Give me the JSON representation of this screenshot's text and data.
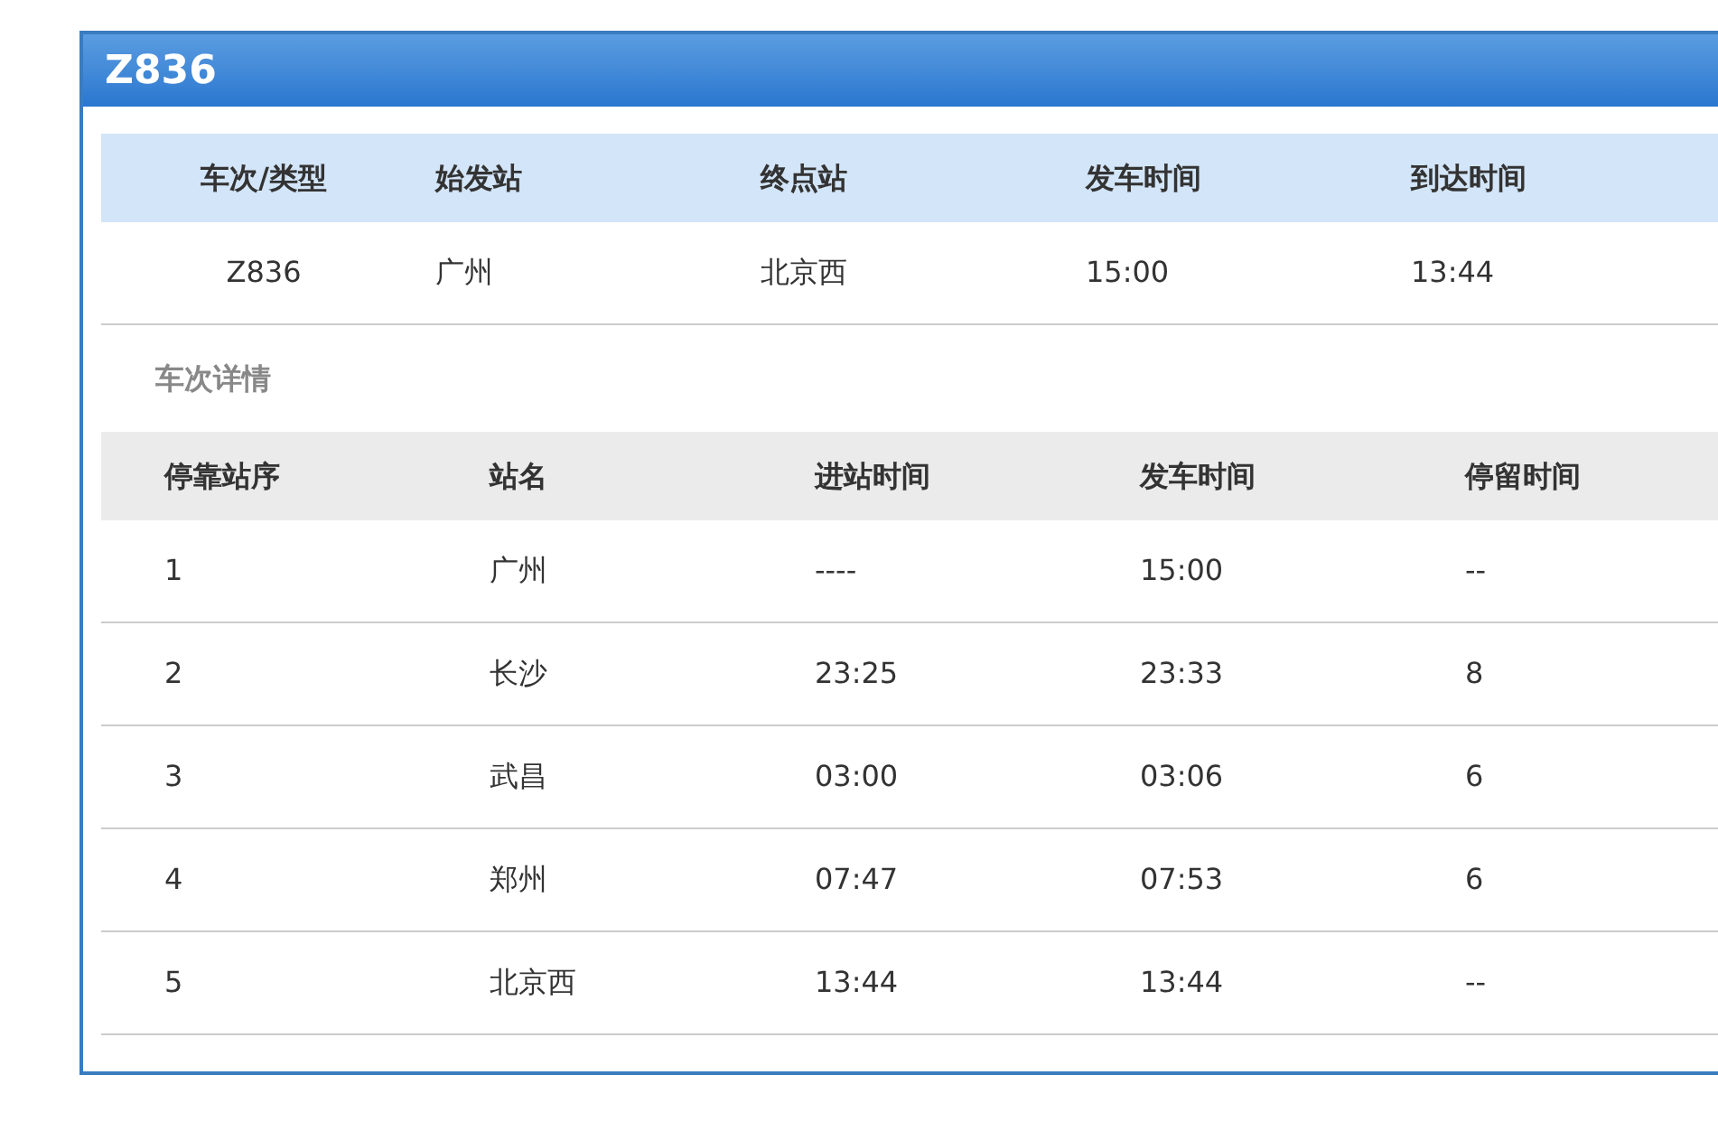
{
  "panel": {
    "title": "Z836"
  },
  "summary": {
    "columns": [
      "车次/类型",
      "始发站",
      "终点站",
      "发车时间",
      "到达时间"
    ],
    "rows": [
      [
        "Z836",
        "广州",
        "北京西",
        "15:00",
        "13:44"
      ]
    ]
  },
  "details": {
    "title": "车次详情",
    "columns": [
      "停靠站序",
      "站名",
      "进站时间",
      "发车时间",
      "停留时间"
    ],
    "rows": [
      [
        "1",
        "广州",
        "----",
        "15:00",
        "--"
      ],
      [
        "2",
        "长沙",
        "23:25",
        "23:33",
        "8"
      ],
      [
        "3",
        "武昌",
        "03:00",
        "03:06",
        "6"
      ],
      [
        "4",
        "郑州",
        "07:47",
        "07:53",
        "6"
      ],
      [
        "5",
        "北京西",
        "13:44",
        "13:44",
        "--"
      ]
    ]
  }
}
